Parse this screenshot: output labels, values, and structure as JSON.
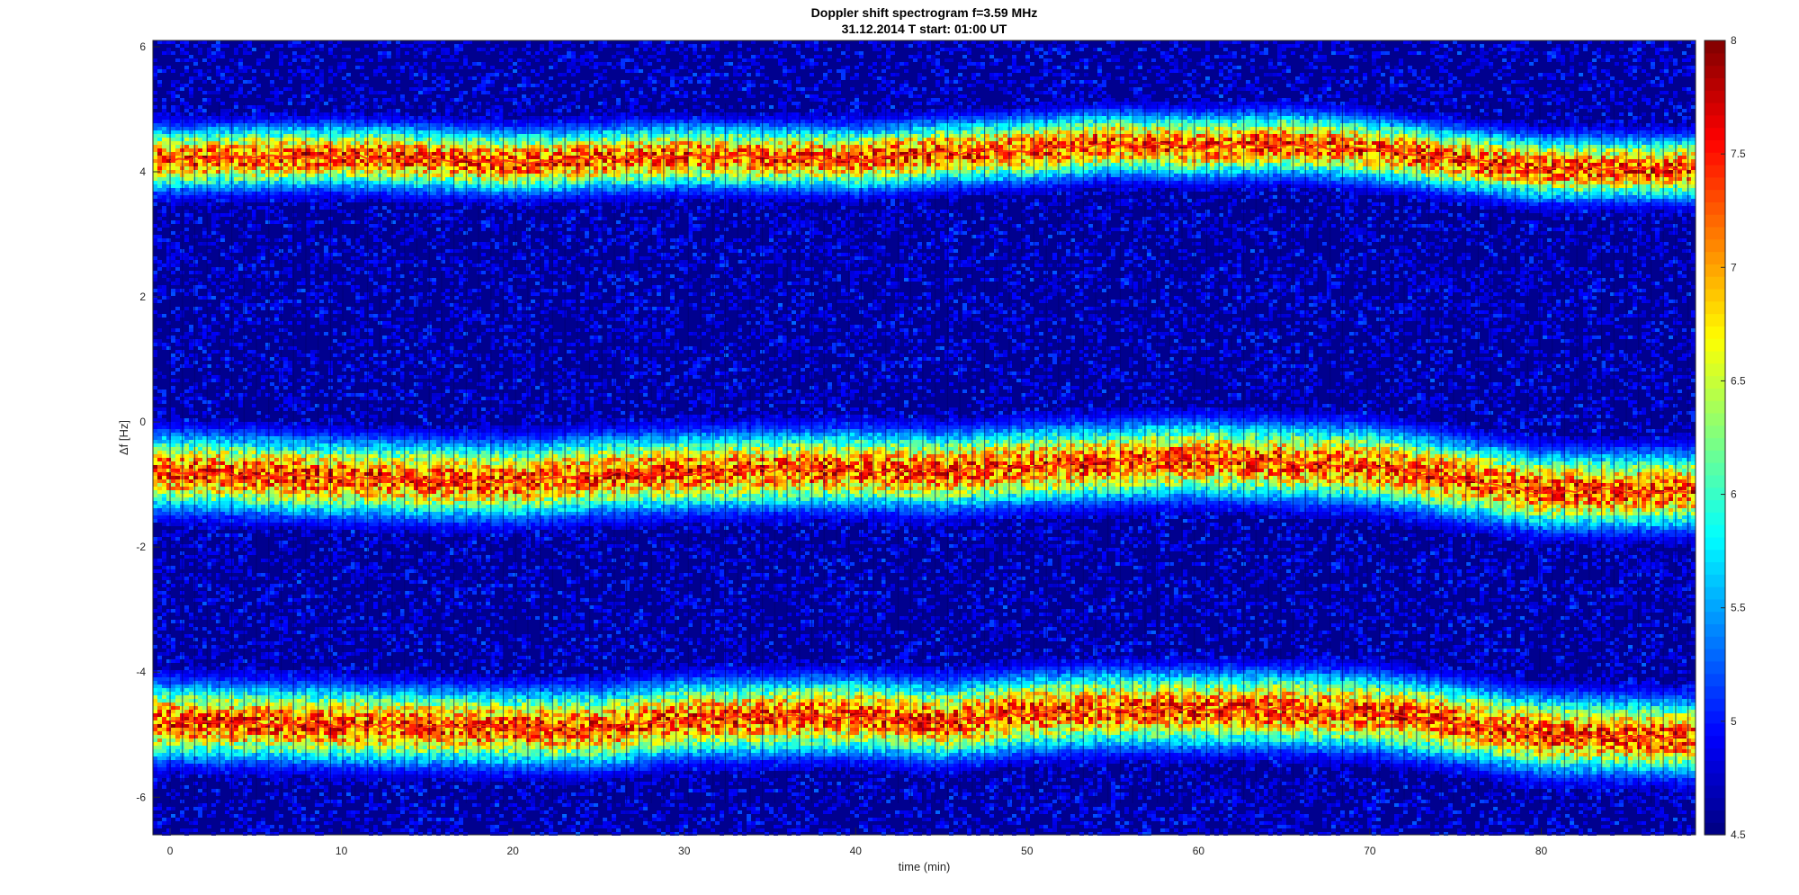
{
  "chart_data": {
    "type": "heatmap",
    "title": "Doppler shift spectrogram f=3.59 MHz",
    "subtitle": "31.12.2014   T start: 01:00 UT",
    "xlabel": "time (min)",
    "ylabel": "Δf [Hz]",
    "xlim": [
      -1,
      89
    ],
    "ylim": [
      -6.6,
      6.1
    ],
    "x_ticks": [
      "0",
      "10",
      "20",
      "30",
      "40",
      "50",
      "60",
      "70",
      "80"
    ],
    "x_tick_values": [
      0,
      10,
      20,
      30,
      40,
      50,
      60,
      70,
      80
    ],
    "y_ticks": [
      "6",
      "4",
      "2",
      "0",
      "-2",
      "-4",
      "-6"
    ],
    "y_tick_values": [
      6,
      4,
      2,
      0,
      -2,
      -4,
      -6
    ],
    "colorbar": {
      "range": [
        4.5,
        8
      ],
      "ticks": [
        "8",
        "7.5",
        "7",
        "6.5",
        "6",
        "5.5",
        "5",
        "4.5"
      ],
      "tick_values": [
        8,
        7.5,
        7,
        6.5,
        6,
        5.5,
        5,
        4.5
      ],
      "colormap": "jet"
    },
    "series": [
      {
        "x": [
          0,
          10,
          20,
          25,
          30,
          40,
          45,
          50,
          55,
          60,
          65,
          70,
          75,
          80,
          89
        ],
        "y": [
          4.2,
          4.25,
          4.15,
          4.2,
          4.25,
          4.2,
          4.3,
          4.35,
          4.45,
          4.4,
          4.45,
          4.35,
          4.2,
          4.05,
          4.05
        ]
      },
      {
        "x": [
          0,
          10,
          20,
          25,
          30,
          40,
          45,
          50,
          55,
          60,
          65,
          70,
          75,
          80,
          89
        ],
        "y": [
          -0.8,
          -0.9,
          -0.95,
          -0.85,
          -0.8,
          -0.75,
          -0.8,
          -0.7,
          -0.65,
          -0.6,
          -0.65,
          -0.7,
          -0.9,
          -1.1,
          -1.1
        ]
      },
      {
        "x": [
          0,
          10,
          20,
          25,
          30,
          40,
          45,
          50,
          55,
          60,
          65,
          70,
          75,
          80,
          89
        ],
        "y": [
          -4.8,
          -4.85,
          -4.9,
          -4.9,
          -4.75,
          -4.7,
          -4.8,
          -4.65,
          -4.6,
          -4.6,
          -4.6,
          -4.65,
          -4.8,
          -5.0,
          -5.05
        ]
      }
    ],
    "colors": {
      "background": "#00008f",
      "trace": "#ff2010",
      "annotation": "#000000"
    }
  }
}
